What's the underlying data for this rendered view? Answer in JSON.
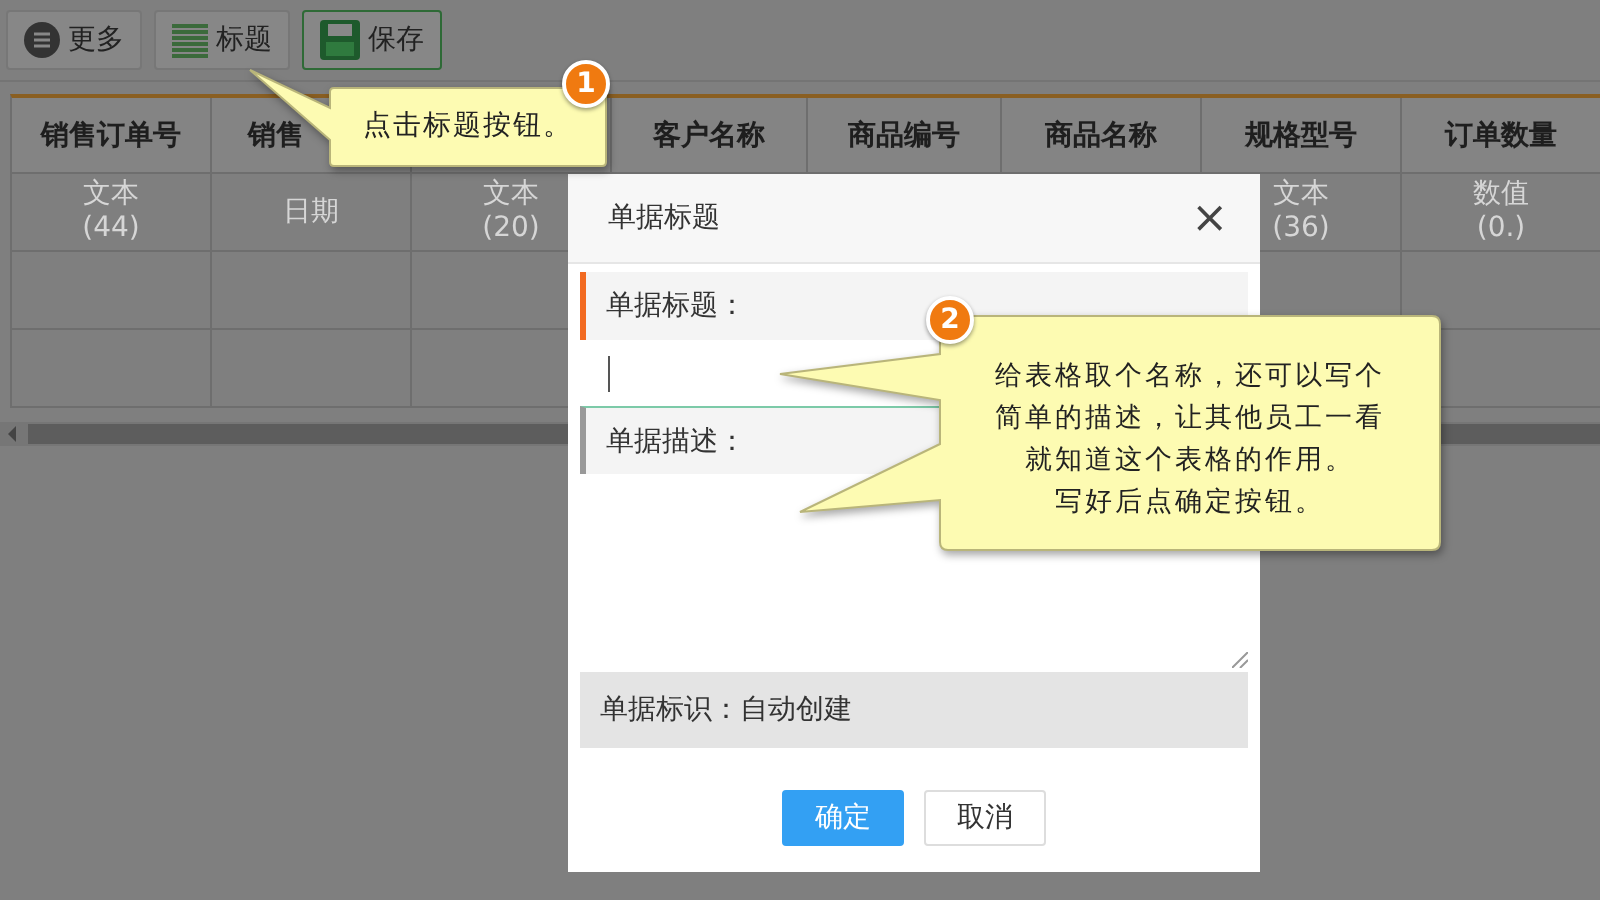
{
  "toolbar": {
    "buttons": [
      {
        "kind": "more",
        "label": "更多"
      },
      {
        "kind": "title",
        "label": "标题"
      },
      {
        "kind": "save",
        "label": "保存"
      }
    ]
  },
  "table": {
    "columns": [
      {
        "label": "销售订单号"
      },
      {
        "label": "销售"
      },
      {},
      {
        "label": "客户名称"
      },
      {
        "label": "商品编号"
      },
      {
        "label": "商品名称"
      },
      {
        "label": "规格型号"
      },
      {
        "label": "订单数量"
      }
    ],
    "rows": [
      [
        {
          "text": "文本\n(44)"
        },
        {
          "text": "日期"
        },
        {
          "text": "文本\n(20)"
        },
        {},
        {},
        {},
        {
          "text": "文本\n(36)"
        },
        {
          "text": "数值\n(0.)"
        }
      ],
      [
        {},
        {},
        {},
        {},
        {},
        {},
        {},
        {}
      ],
      [
        {},
        {},
        {},
        {},
        {},
        {},
        {},
        {}
      ]
    ]
  },
  "dialog": {
    "title": "单据标题",
    "close": "×",
    "fields": [
      {
        "kind": "input",
        "label": "单据标题：",
        "focused": true
      },
      {
        "kind": "textarea",
        "label": "单据描述：",
        "focused": false
      }
    ],
    "identifier": "单据标识：自动创建",
    "buttons": [
      {
        "label": "确定",
        "primary": true
      },
      {
        "label": "取消",
        "primary": false
      }
    ]
  },
  "callouts": [
    {
      "number": "1",
      "lines": [
        "点击标题按钮。"
      ]
    },
    {
      "number": "2",
      "lines": [
        "给表格取个名称，还可以写个",
        "简单的描述，让其他员工一看",
        "就知道这个表格的作用。",
        "写好后点确定按钮。"
      ]
    }
  ]
}
